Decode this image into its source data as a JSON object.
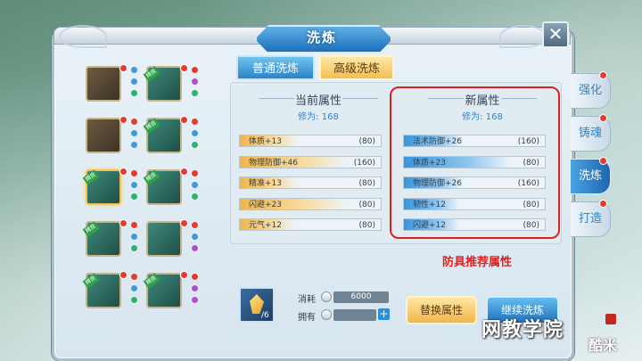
{
  "window": {
    "title": "洗炼",
    "close_icon": "close-icon"
  },
  "tabs": [
    {
      "label": "普通洗炼",
      "active": false
    },
    {
      "label": "高级洗炼",
      "active": true
    }
  ],
  "side_tabs": [
    {
      "label": "强化",
      "active": false
    },
    {
      "label": "铸魂",
      "active": false
    },
    {
      "label": "洗炼",
      "active": true
    },
    {
      "label": "打造",
      "active": false
    }
  ],
  "equipment_badge": "精良",
  "current": {
    "header": "当前属性",
    "mastery": "修为: 168",
    "rows": [
      {
        "name": "体质+13",
        "cap": "(80)",
        "fill": 0.16
      },
      {
        "name": "物理防御+46",
        "cap": "(160)",
        "fill": 0.29
      },
      {
        "name": "精准+13",
        "cap": "(80)",
        "fill": 0.16
      },
      {
        "name": "闪避+23",
        "cap": "(80)",
        "fill": 0.29
      },
      {
        "name": "元气+12",
        "cap": "(80)",
        "fill": 0.15
      }
    ]
  },
  "new_attrs": {
    "header": "新属性",
    "mastery": "修为: 168",
    "rows": [
      {
        "name": "法术防御+26",
        "cap": "(160)",
        "fill": 0.16
      },
      {
        "name": "体质+23",
        "cap": "(80)",
        "fill": 0.29
      },
      {
        "name": "物理防御+26",
        "cap": "(160)",
        "fill": 0.16
      },
      {
        "name": "韧性+12",
        "cap": "(80)",
        "fill": 0.15
      },
      {
        "name": "闪避+12",
        "cap": "(80)",
        "fill": 0.15
      }
    ]
  },
  "annotation": "防具推荐属性",
  "cost": {
    "consume_label": "消耗",
    "consume_value": "6000",
    "own_label": "拥有",
    "own_value": "",
    "material_count": "/6"
  },
  "buttons": {
    "replace": "替换属性",
    "continue": "继续洗炼"
  },
  "watermark": "网教学院",
  "brand": "酷米",
  "colors": {
    "accent_blue": "#2e86c9",
    "gold": "#f2b54a",
    "annotation_red": "#e02020"
  }
}
